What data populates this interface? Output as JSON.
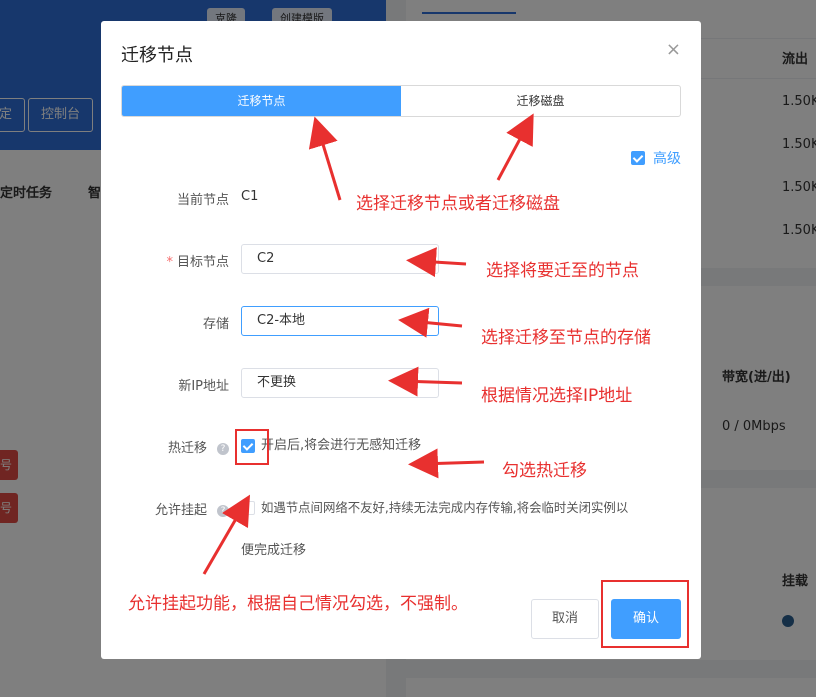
{
  "background": {
    "top_buttons": [
      "克隆",
      "创建模版"
    ],
    "left_buttons": [
      "定",
      "控制台"
    ],
    "left_tabs": [
      "定时任务",
      "智"
    ],
    "red_tags": [
      "号",
      "号"
    ],
    "right": {
      "outflow_header": "流出",
      "outflow_values": [
        "1.50K",
        "1.50K",
        "1.50K",
        "1.50K"
      ],
      "bandwidth_header": "带宽(进/出)",
      "bandwidth_value": "0 / 0Mbps",
      "mount_header": "挂载"
    }
  },
  "dialog": {
    "title": "迁移节点",
    "close_icon": "×",
    "tabs": [
      {
        "label": "迁移节点",
        "active": true
      },
      {
        "label": "迁移磁盘",
        "active": false
      }
    ],
    "advanced": {
      "label": "高级",
      "checked": true
    },
    "current_node": {
      "label": "当前节点",
      "value": "C1"
    },
    "target_node": {
      "label": "目标节点",
      "required_mark": "*",
      "value": "C2"
    },
    "storage": {
      "label": "存储",
      "value": "C2-本地"
    },
    "new_ip": {
      "label": "新IP地址",
      "value": "不更换"
    },
    "hot_migration": {
      "label": "热迁移",
      "help": "?",
      "checked": true,
      "text": "开启后,将会进行无感知迁移"
    },
    "allow_suspend": {
      "label": "允许挂起",
      "help": "?",
      "checked": false,
      "text_line1": "如遇节点间网络不友好,持续无法完成内存传输,将会临时关闭实例以",
      "text_line2": "便完成迁移"
    },
    "cancel_label": "取消",
    "confirm_label": "确认"
  },
  "annotations": {
    "tabs": "选择迁移节点或者迁移磁盘",
    "target": "选择将要迁至的节点",
    "storage": "选择迁移至节点的存储",
    "ip": "根据情况选择IP地址",
    "hot": "勾选热迁移",
    "suspend": "允许挂起功能，根据自己情况勾选，不强制。",
    "color": "#e8302f"
  }
}
